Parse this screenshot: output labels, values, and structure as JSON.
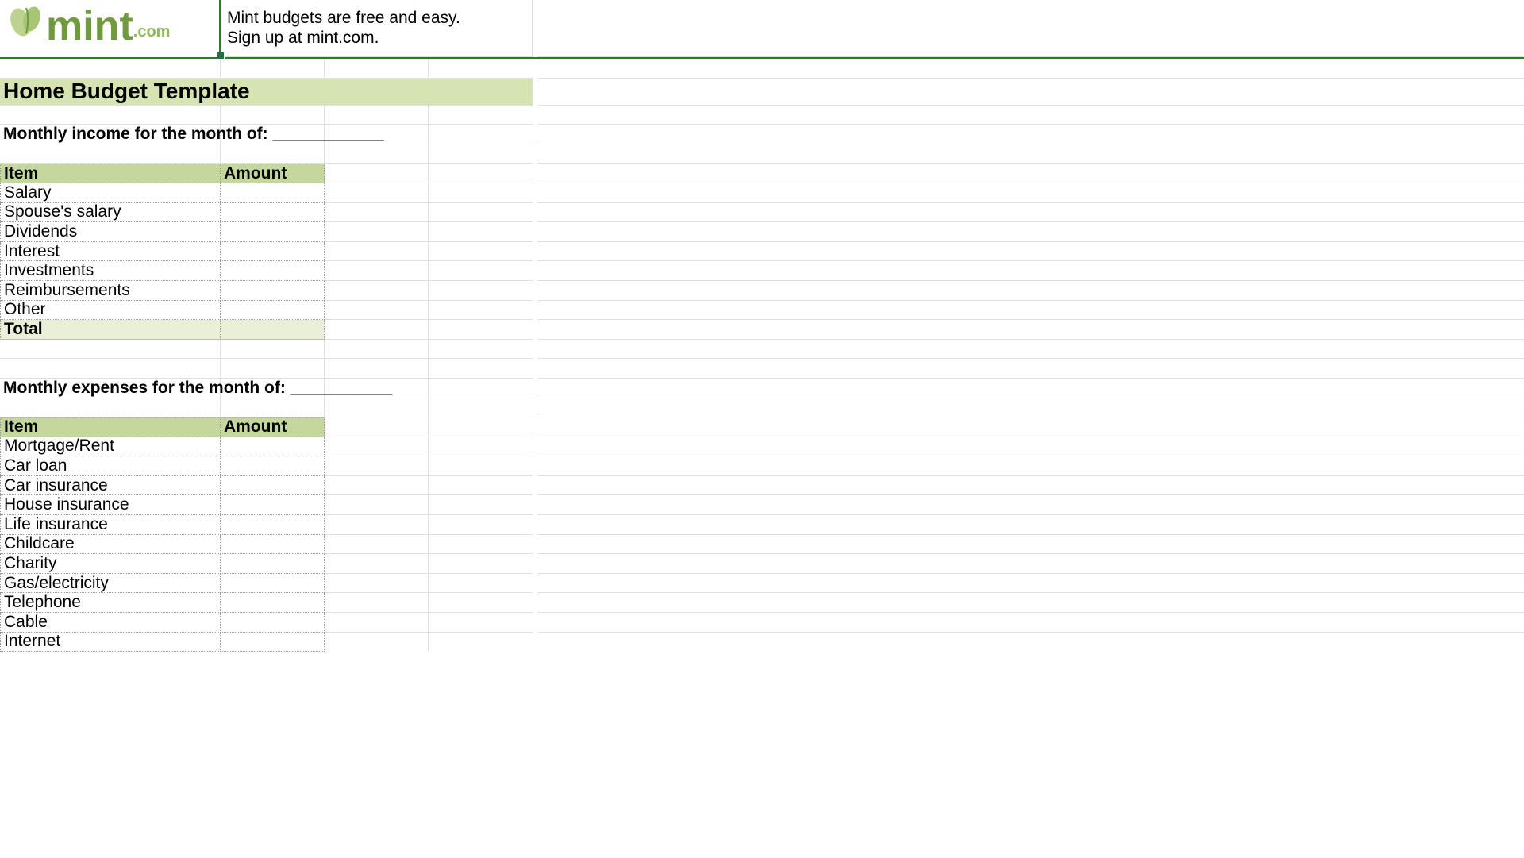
{
  "brand": {
    "name": "mint",
    "suffix": ".com",
    "tagline_line1": "Mint budgets are free and easy.",
    "tagline_line2": "Sign up at mint.com."
  },
  "title": "Home Budget Template",
  "income": {
    "section_label": "Monthly income for the month of: ____________",
    "headers": {
      "item": "Item",
      "amount": "Amount"
    },
    "items": [
      {
        "label": "Salary",
        "amount": ""
      },
      {
        "label": "Spouse's salary",
        "amount": ""
      },
      {
        "label": "Dividends",
        "amount": ""
      },
      {
        "label": "Interest",
        "amount": ""
      },
      {
        "label": "Investments",
        "amount": ""
      },
      {
        "label": "Reimbursements",
        "amount": ""
      },
      {
        "label": "Other",
        "amount": ""
      }
    ],
    "total_label": "Total",
    "total_amount": ""
  },
  "expenses": {
    "section_label": "Monthly expenses for the month of: ___________",
    "headers": {
      "item": "Item",
      "amount": "Amount"
    },
    "items": [
      {
        "label": "Mortgage/Rent",
        "amount": ""
      },
      {
        "label": "Car loan",
        "amount": ""
      },
      {
        "label": "Car insurance",
        "amount": ""
      },
      {
        "label": "House insurance",
        "amount": ""
      },
      {
        "label": "Life insurance",
        "amount": ""
      },
      {
        "label": "Childcare",
        "amount": ""
      },
      {
        "label": "Charity",
        "amount": ""
      },
      {
        "label": "Gas/electricity",
        "amount": ""
      },
      {
        "label": "Telephone",
        "amount": ""
      },
      {
        "label": "Cable",
        "amount": ""
      },
      {
        "label": "Internet",
        "amount": ""
      }
    ]
  }
}
